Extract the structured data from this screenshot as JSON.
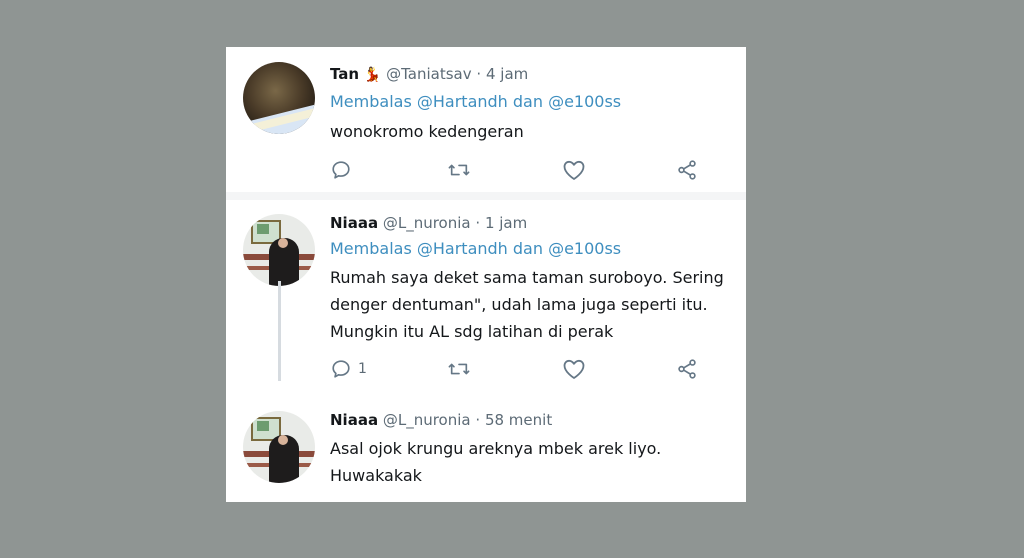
{
  "tweets": [
    {
      "name": "Tan",
      "emoji": "💃",
      "handle": "@Taniatsav",
      "time": "4 jam",
      "reply_prefix": "Membalas",
      "reply_to": "@Hartandh dan @e100ss",
      "lines": [
        "wonokromo kedengeran"
      ],
      "reply_count": ""
    },
    {
      "name": "Niaaa",
      "handle": "@L_nuronia",
      "time": "1 jam",
      "reply_prefix": "Membalas",
      "reply_to": "@Hartandh dan @e100ss",
      "lines": [
        "Rumah saya deket sama taman suroboyo. Sering",
        "denger dentuman\", udah lama juga seperti itu.",
        "Mungkin itu AL sdg latihan di perak"
      ],
      "reply_count": "1"
    },
    {
      "name": "Niaaa",
      "handle": "@L_nuronia",
      "time": "58 menit",
      "lines": [
        "Asal ojok krungu areknya mbek arek liyo.",
        "Huwakakak"
      ]
    }
  ],
  "icons": [
    "reply-icon",
    "retweet-icon",
    "like-icon",
    "share-icon"
  ],
  "colors": {
    "link": "#3e8ebf",
    "muted": "#5d6b76",
    "background": "#8f9593"
  }
}
